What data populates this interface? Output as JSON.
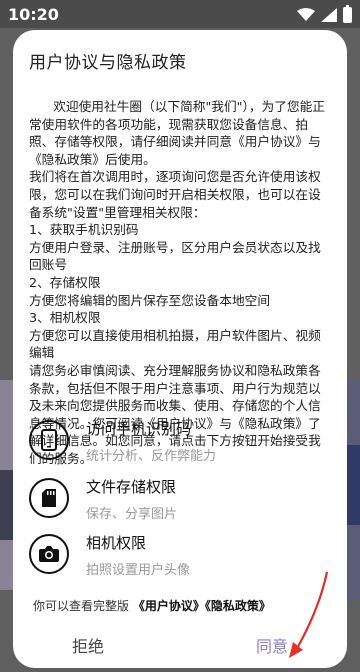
{
  "status_bar": {
    "time": "10:20"
  },
  "dialog": {
    "title": "用户协议与隐私政策",
    "body": "      欢迎使用社牛圈（以下简称\"我们\"），为了您能正常使用软件的各项功能，现需获取您设备信息、拍照、存储等权限，请仔细阅读并同意《用户协议》与《隐私政策》后使用。\n我们将在首次调用时，逐项询问您是否允许使用该权限，您可以在我们询问时开启相关权限，也可以在设备系统\"设置\"里管理相关权限：\n1、获取手机识别码\n方便用户登录、注册账号，区分用户会员状态以及找回账号\n2、存储权限\n方便您将编辑的图片保存至您设备本地空间\n3、相机权限\n方便您可以直接使用相机拍摄，用户软件图片、视频编辑\n请您务必审慎阅读、充分理解服务协议和隐私政策各条款，包括但不限于用户注意事项、用户行为规范以及未来向您提供服务而收集、使用、存储您的个人信息等情况。您可阅读《用户协议》与《隐私政策》了解详细信息。如您同意，请点击下方按钮开始接受我们的服务。",
    "permissions": [
      {
        "icon": "phone-icon",
        "title": "访问手机识别码",
        "desc": "统计分析、反作弊能力"
      },
      {
        "icon": "sd-card-icon",
        "title": "文件存储权限",
        "desc": "保存、分享图片"
      },
      {
        "icon": "camera-icon",
        "title": "相机权限",
        "desc": "拍照设置用户头像"
      }
    ],
    "footer_prefix": "你可以查看完整版",
    "user_agreement_link": "《用户协议》",
    "privacy_link": "《隐私政策》",
    "reject_label": "拒绝",
    "agree_label": "同意"
  },
  "colors": {
    "agree": "#8a80c9",
    "arrow": "#e0302a"
  }
}
